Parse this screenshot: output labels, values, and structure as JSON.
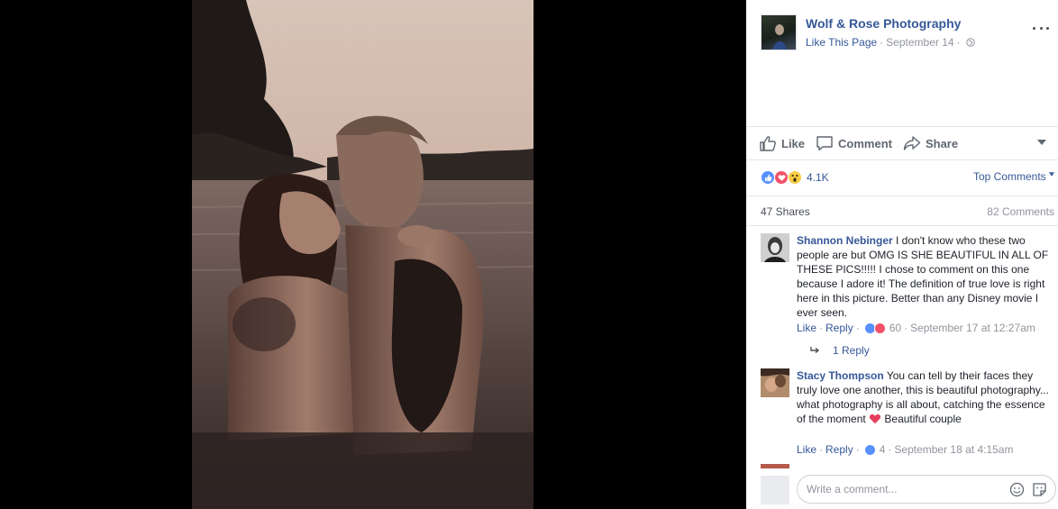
{
  "post": {
    "page_name": "Wolf & Rose Photography",
    "like_page_label": "Like This Page",
    "separator": "·",
    "date": "September 14"
  },
  "actions": {
    "like_label": "Like",
    "comment_label": "Comment",
    "share_label": "Share"
  },
  "reactions": {
    "count": "4.1K",
    "types": [
      "like",
      "love",
      "wow"
    ],
    "sort_label": "Top Comments"
  },
  "stats": {
    "shares": "47 Shares",
    "comments": "82 Comments"
  },
  "comments": [
    {
      "author": "Shannon Nebinger",
      "text": "I don't know who these two people are but OMG IS SHE BEAUTIFUL IN ALL OF THESE PICS!!!!! I chose to comment on this one because I adore it! The definition of true love is right here in this picture. Better than any Disney movie I ever seen.",
      "like_label": "Like",
      "reply_label": "Reply",
      "reaction_count": "60",
      "reaction_types": [
        "like",
        "love"
      ],
      "timestamp": "September 17 at 12:27am",
      "replies_label": "1 Reply"
    },
    {
      "author": "Stacy Thompson",
      "text_before_emoji": "You can tell by their faces they truly love one another, this is beautiful photography... what photography is all about, catching the essence of the moment",
      "emoji": "heart-icon",
      "text_after_emoji": "Beautiful couple",
      "like_label": "Like",
      "reply_label": "Reply",
      "reaction_count": "4",
      "reaction_types": [
        "like"
      ],
      "timestamp": "September 18 at 4:15am"
    }
  ],
  "composer": {
    "placeholder": "Write a comment...",
    "icons": [
      "emoji-icon",
      "sticker-icon"
    ]
  },
  "colors": {
    "link": "#365899",
    "muted": "#90949c",
    "like_blue": "#5890ff",
    "love_red": "#f25268",
    "wow_yellow": "#f7cd44"
  }
}
